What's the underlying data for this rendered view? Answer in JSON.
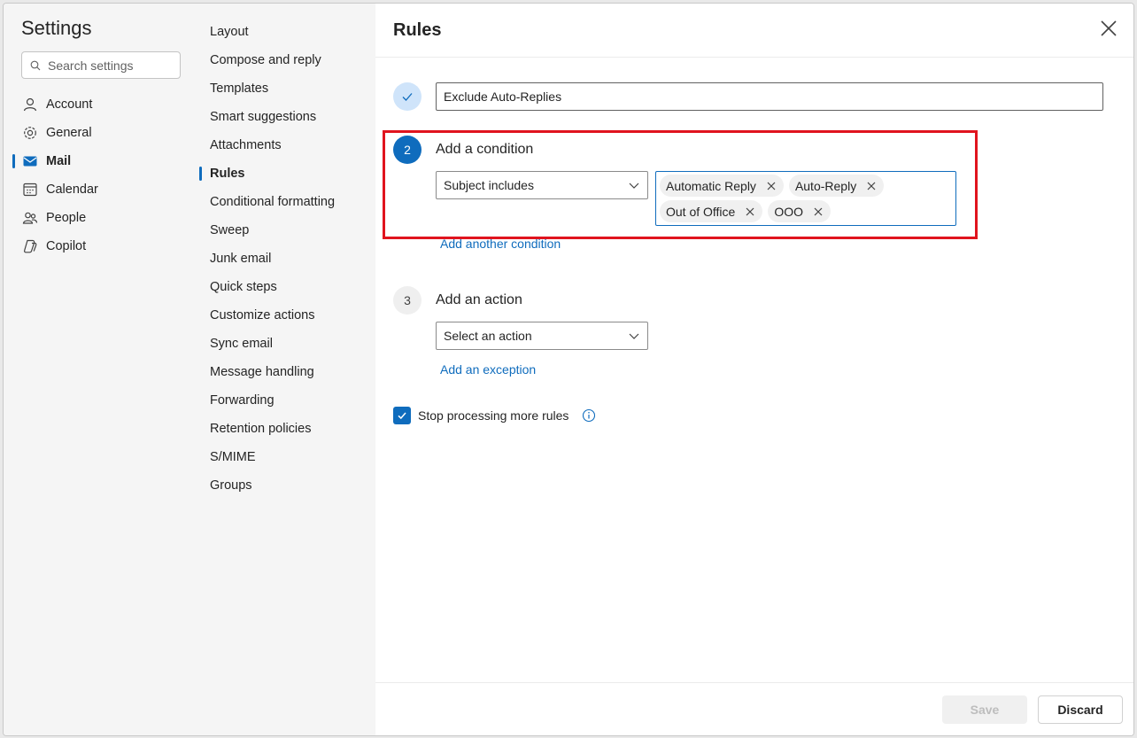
{
  "settings": {
    "title": "Settings",
    "search_placeholder": "Search settings"
  },
  "nav": {
    "items": [
      {
        "label": "Account",
        "icon": "person-icon"
      },
      {
        "label": "General",
        "icon": "gear-icon"
      },
      {
        "label": "Mail",
        "icon": "mail-icon",
        "active": true
      },
      {
        "label": "Calendar",
        "icon": "calendar-icon"
      },
      {
        "label": "People",
        "icon": "people-icon"
      },
      {
        "label": "Copilot",
        "icon": "copilot-icon"
      }
    ]
  },
  "subnav": {
    "items": [
      "Layout",
      "Compose and reply",
      "Templates",
      "Smart suggestions",
      "Attachments",
      "Rules",
      "Conditional formatting",
      "Sweep",
      "Junk email",
      "Quick steps",
      "Customize actions",
      "Sync email",
      "Message handling",
      "Forwarding",
      "Retention policies",
      "S/MIME",
      "Groups"
    ],
    "active": "Rules"
  },
  "rules": {
    "title": "Rules",
    "rule_name": "Exclude Auto-Replies",
    "step2": {
      "number": "2",
      "label": "Add a condition",
      "condition": "Subject includes",
      "chips": [
        "Automatic Reply",
        "Auto-Reply",
        "Out of Office",
        "OOO"
      ],
      "add_link": "Add another condition"
    },
    "step3": {
      "number": "3",
      "label": "Add an action",
      "action_placeholder": "Select an action",
      "exception_link": "Add an exception"
    },
    "stop_processing": {
      "label": "Stop processing more rules",
      "checked": true
    },
    "buttons": {
      "save": "Save",
      "discard": "Discard"
    }
  },
  "colors": {
    "accent": "#0f6cbd",
    "highlight": "#e0141e"
  }
}
